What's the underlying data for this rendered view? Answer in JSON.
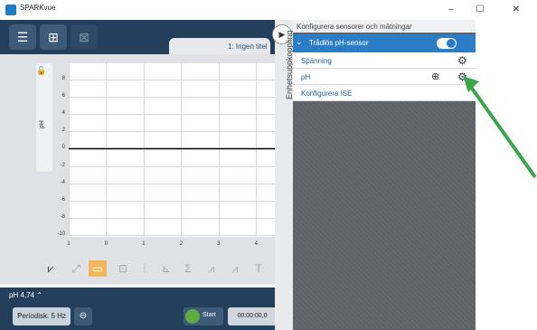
{
  "window": {
    "title": "SPARKvue",
    "minimize": "–",
    "maximize": "☐",
    "close": "✕"
  },
  "tab": {
    "title": "1: Ingen titel"
  },
  "graph": {
    "y_axis_label": "pH",
    "y_ticks": [
      "8",
      "6",
      "4",
      "2",
      "0",
      "-2",
      "-4",
      "-6",
      "-8",
      "-10"
    ],
    "x_ticks": [
      "1",
      "0",
      "1",
      "2",
      "3",
      "4"
    ]
  },
  "bottom": {
    "readout": "pH 4,74 ⌃",
    "periodic": "Periodisk: 5 Hz",
    "start": "Start",
    "timer": "00:00:00,0"
  },
  "side": {
    "label": "Enhetsuppkoppling",
    "collapse": "▶"
  },
  "panel": {
    "title": "Konfigurera sensorer och mätningar",
    "sensor_name": "Trådlös pH-sensor",
    "chevron": "⌄",
    "rows": [
      {
        "label": "Spänning"
      },
      {
        "label": "pH"
      },
      {
        "label": "Konfigurera ISE"
      }
    ]
  },
  "colors": {
    "accent": "#2b7ec5",
    "dark": "#233f5c",
    "arrow": "#3aa54b"
  }
}
